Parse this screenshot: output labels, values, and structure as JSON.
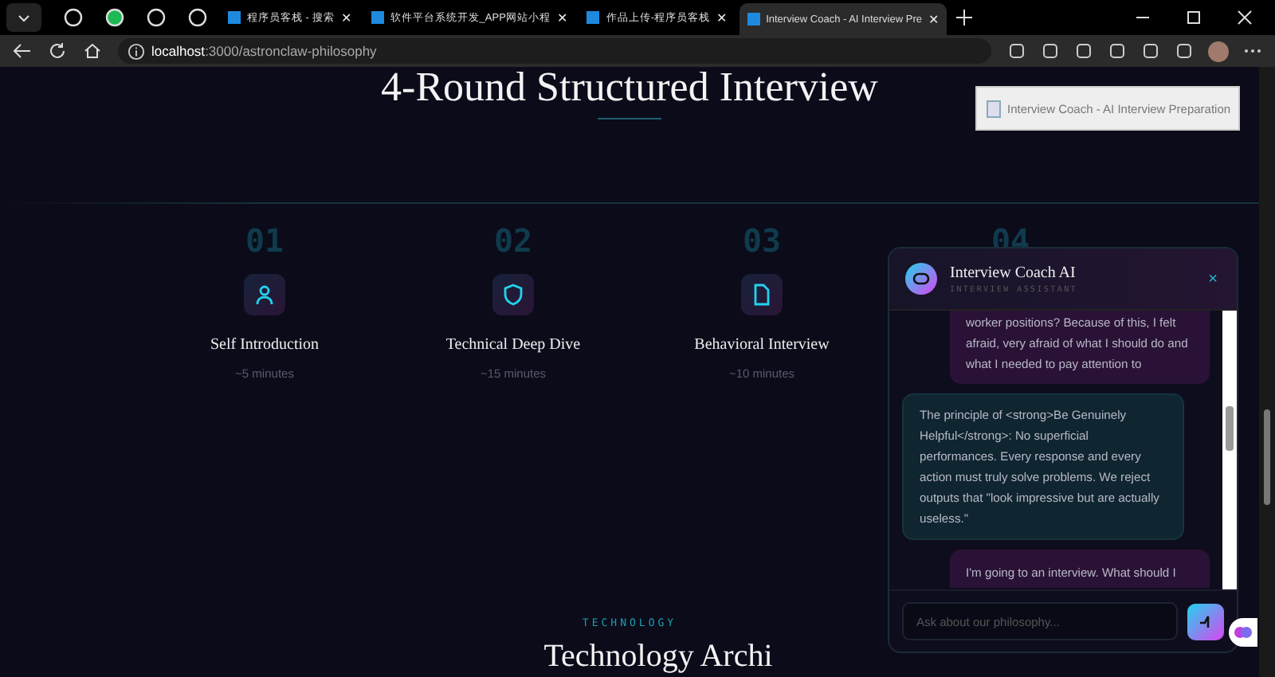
{
  "browser": {
    "tabs": [
      {
        "kind": "pinned",
        "selected": false
      },
      {
        "kind": "pinned",
        "selected": false
      },
      {
        "kind": "pinned",
        "selected": false
      },
      {
        "kind": "pinned",
        "selected": false
      },
      {
        "kind": "page",
        "title": "程序员客栈 - 搜索",
        "close": "✕",
        "selected": false
      },
      {
        "kind": "page",
        "title": "软件平台系统开发_APP网站小程",
        "close": "✕",
        "selected": false
      },
      {
        "kind": "page",
        "title": "作品上传-程序员客栈",
        "close": "✕",
        "selected": false
      },
      {
        "kind": "page",
        "title": "Interview Coach - AI Interview Pre",
        "close": "✕",
        "selected": true
      }
    ],
    "url_host": "localhost",
    "url_path": ":3000/astronclaw-philosophy",
    "tooltip": "Interview Coach - AI Interview Preparation"
  },
  "page": {
    "heading": "4-Round Structured Interview",
    "rounds": [
      {
        "number": "01",
        "title": "Self Introduction",
        "duration": "~5 minutes"
      },
      {
        "number": "02",
        "title": "Technical Deep Dive",
        "duration": "~15 minutes"
      },
      {
        "number": "03",
        "title": "Behavioral Interview",
        "duration": "~10 minutes"
      },
      {
        "number": "04"
      }
    ],
    "section_label": "TECHNOLOGY",
    "section_title": "Technology Archi"
  },
  "chat": {
    "title": "Interview Coach AI",
    "subtitle": "INTERVIEW ASSISTANT",
    "close": "×",
    "messages": [
      {
        "kind": "user",
        "text": "worker positions? Because of this, I felt afraid, very afraid of what I should do and what I needed to pay attention to"
      },
      {
        "kind": "assistant",
        "text": "The principle of <strong>Be Genuinely Helpful</strong>: No superficial performances. Every response and every action must truly solve problems. We reject outputs that \"look impressive but are actually useless.\""
      },
      {
        "kind": "user",
        "text": "I'm going to an interview. What should I"
      }
    ],
    "input": {
      "placeholder": "Ask about our philosophy..."
    }
  }
}
